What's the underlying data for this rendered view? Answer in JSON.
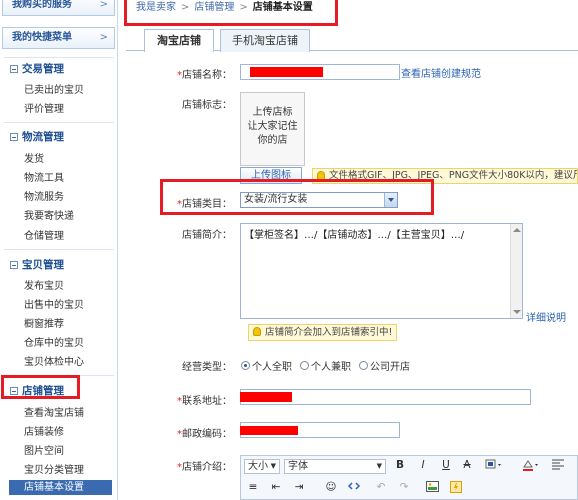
{
  "sidebar": {
    "btn_purchased": "我购买的服务",
    "btn_shortcut": "我的快捷菜单",
    "chevron": ">",
    "sections": [
      {
        "title": "交易管理",
        "items": [
          "已卖出的宝贝",
          "评价管理"
        ]
      },
      {
        "title": "物流管理",
        "items": [
          "发货",
          "物流工具",
          "物流服务",
          "我要寄快递",
          "仓储管理"
        ]
      },
      {
        "title": "宝贝管理",
        "items": [
          "发布宝贝",
          "出售中的宝贝",
          "橱窗推荐",
          "仓库中的宝贝",
          "宝贝体检中心"
        ]
      },
      {
        "title": "店铺管理",
        "items": [
          "查看淘宝店铺",
          "店铺装修",
          "图片空间",
          "宝贝分类管理",
          "店铺基本设置"
        ]
      }
    ]
  },
  "breadcrumb": {
    "c1": "我是卖家",
    "c2": "店铺管理",
    "current": "店铺基本设置",
    "sep": ">"
  },
  "tabs": [
    "淘宝店铺",
    "手机淘宝店铺"
  ],
  "form": {
    "req_mark": "*",
    "shop_name_label": "店铺名称：",
    "shop_name_link": "查看店铺创建规范",
    "logo_label": "店铺标志：",
    "logo_line1": "上传店标",
    "logo_line2": "让大家记住",
    "logo_line3": "你的店",
    "upload_btn": "上传图标",
    "logo_tip": "文件格式GIF、JPG、JPEG、PNG文件大小80K以内，建议尺",
    "category_label": "店铺类目：",
    "category_value": "女装/流行女装",
    "intro_label": "店铺简介：",
    "intro_value": "【掌柜签名】…/【店铺动态】…/【主营宝贝】…/",
    "intro_link": "详细说明",
    "intro_tip": "店铺简介会加入到店铺索引中!",
    "type_label": "经营类型：",
    "type_options": [
      "个人全职",
      "个人兼职",
      "公司开店"
    ],
    "address_label": "联系地址：",
    "zip_label": "邮政编码：",
    "desc_label": "店铺介绍："
  },
  "editor": {
    "font_size": "大小",
    "font_family": "字体",
    "bold": "B",
    "italic": "I",
    "underline": "U",
    "strike": "A",
    "row2": [
      "≡",
      "⇤",
      "⇥",
      "☺",
      "↶",
      "↷"
    ]
  },
  "colors": {
    "accent": "#e51c23",
    "link": "#2b62b3",
    "sidebar_active": "#3a6ab0"
  }
}
